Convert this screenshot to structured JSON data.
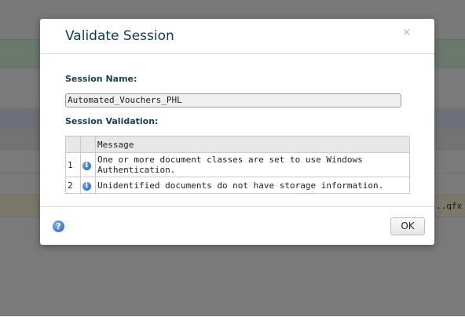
{
  "background": {
    "file_fragment": "..qfx"
  },
  "dialog": {
    "title": "Validate Session",
    "close_glyph": "×",
    "session_name_label": "Session Name:",
    "session_name_value": "Automated_Vouchers_PHL",
    "session_validation_label": "Session Validation:",
    "table": {
      "header": "Message",
      "rows": [
        {
          "num": "1",
          "icon": "info-icon",
          "message": "One or more document classes are set to use Windows Authentication."
        },
        {
          "num": "2",
          "icon": "info-icon",
          "message": "Unidentified documents do not have storage information."
        }
      ]
    },
    "help_glyph": "?",
    "ok_label": "OK"
  },
  "colors": {
    "title": "#0e3a52",
    "overlay": "rgba(0,0,0,0.5)",
    "info_icon": "#1e5fb8"
  }
}
